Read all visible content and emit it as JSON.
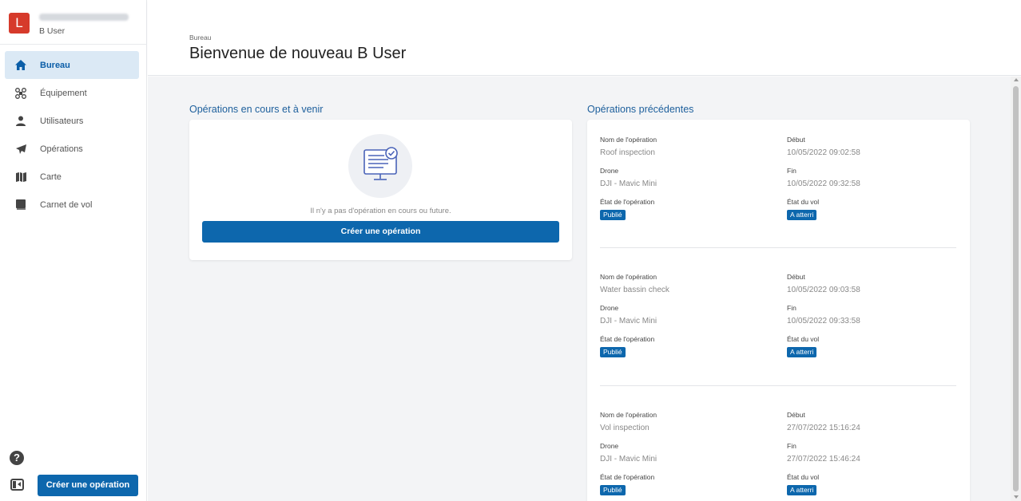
{
  "org": {
    "logo_letter": "L",
    "user": "B User"
  },
  "nav": [
    {
      "label": "Bureau",
      "icon": "home-icon",
      "active": true
    },
    {
      "label": "Équipement",
      "icon": "drone-icon"
    },
    {
      "label": "Utilisateurs",
      "icon": "user-icon"
    },
    {
      "label": "Opérations",
      "icon": "paper-plane-icon"
    },
    {
      "label": "Carte",
      "icon": "map-icon"
    },
    {
      "label": "Carnet de vol",
      "icon": "book-icon"
    }
  ],
  "sidebar_footer": {
    "help_glyph": "?",
    "create_label": "Créer une opération"
  },
  "header": {
    "breadcrumb": "Bureau",
    "title": "Bienvenue de nouveau B User"
  },
  "current": {
    "title": "Opérations en cours et à venir",
    "empty_text": "Il n'y a pas d'opération en cours ou future.",
    "create_label": "Créer une opération"
  },
  "previous": {
    "title": "Opérations précédentes",
    "labels": {
      "name": "Nom de l'opération",
      "start": "Début",
      "drone": "Drone",
      "end": "Fin",
      "op_state": "État de l'opération",
      "flight_state": "État du vol"
    },
    "operations": [
      {
        "name": "Roof inspection",
        "start": "10/05/2022 09:02:58",
        "drone": "DJI - Mavic Mini",
        "end": "10/05/2022 09:32:58",
        "op_state": "Publié",
        "flight_state": "A atterri"
      },
      {
        "name": "Water bassin check",
        "start": "10/05/2022 09:03:58",
        "drone": "DJI - Mavic Mini",
        "end": "10/05/2022 09:33:58",
        "op_state": "Publié",
        "flight_state": "A atterri"
      },
      {
        "name": "Vol inspection",
        "start": "27/07/2022 15:16:24",
        "drone": "DJI - Mavic Mini",
        "end": "27/07/2022 15:46:24",
        "op_state": "Publié",
        "flight_state": "A atterri"
      }
    ]
  },
  "colors": {
    "primary": "#0d67ad",
    "section_title": "#1d5f9c",
    "active_nav_bg": "#dbe9f5",
    "logo": "#d63a2b"
  }
}
